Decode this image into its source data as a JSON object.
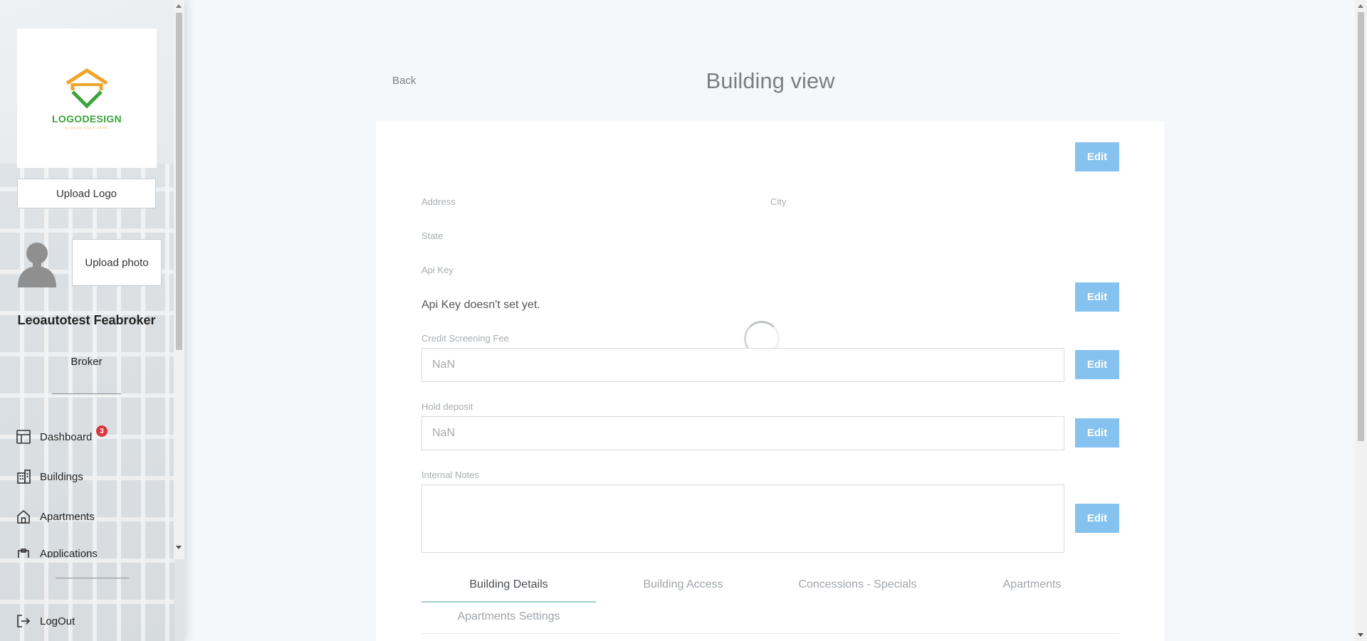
{
  "sidebar": {
    "logo": {
      "text": "LOGODESIGN",
      "tagline": "SLOGAN GOES HERE"
    },
    "upload_logo_label": "Upload Logo",
    "upload_photo_label": "Upload photo",
    "user": {
      "name": "Leoautotest Feabroker",
      "role": "Broker"
    },
    "nav": [
      {
        "label": "Dashboard",
        "icon": "dashboard-icon",
        "badge": "3"
      },
      {
        "label": "Buildings",
        "icon": "buildings-icon"
      },
      {
        "label": "Apartments",
        "icon": "home-icon"
      },
      {
        "label": "Applications",
        "icon": "clipboard-icon"
      }
    ],
    "logout_label": "LogOut"
  },
  "header": {
    "back_label": "Back",
    "title": "Building view"
  },
  "form": {
    "edit_label": "Edit",
    "address_label": "Address",
    "city_label": "City",
    "state_label": "State",
    "api_key_label": "Api Key",
    "api_key_value": "Api Key doesn't set yet.",
    "credit_fee_label": "Credit Screening Fee",
    "credit_fee_value": "NaN",
    "hold_deposit_label": "Hold deposit",
    "hold_deposit_value": "NaN",
    "internal_notes_label": "Internal Notes",
    "internal_notes_value": ""
  },
  "tabs": [
    {
      "label": "Building Details",
      "active": true
    },
    {
      "label": "Building Access"
    },
    {
      "label": "Concessions - Specials"
    },
    {
      "label": "Apartments"
    },
    {
      "label": "Apartments Settings"
    }
  ],
  "colors": {
    "accent": "#85c2f0",
    "badge": "#d9373f",
    "tab_underline": "#9ecfd0"
  }
}
